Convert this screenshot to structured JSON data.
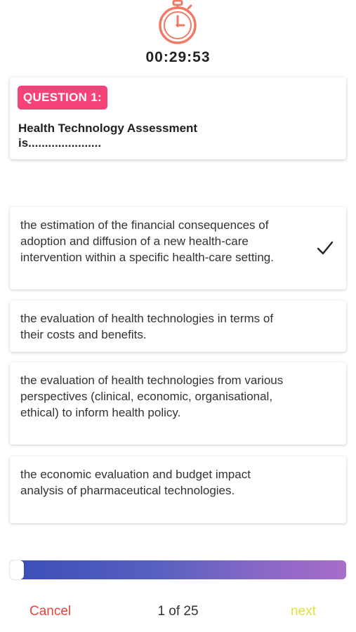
{
  "timer": {
    "value": "00:29:53"
  },
  "question": {
    "badge": "QUESTION 1:",
    "text": "Health Technology Assessment is......................"
  },
  "options": [
    {
      "text": "the estimation of the financial consequences of adoption and diffusion of a new health-care intervention within a specific health-care setting.",
      "selected": true
    },
    {
      "text": "the evaluation of health technologies in terms of their costs and benefits.",
      "selected": false
    },
    {
      "text": "the evaluation of health technologies from various perspectives (clinical, economic, organisational, ethical) to inform health policy.",
      "selected": false
    },
    {
      "text": "the economic evaluation and budget impact analysis of pharmaceutical technologies.",
      "selected": false
    }
  ],
  "progress": {
    "fraction": 0.04
  },
  "footer": {
    "cancel_label": "Cancel",
    "counter": "1 of 25",
    "next_label": "next"
  },
  "colors": {
    "accent": "#f5437a",
    "stopwatch": "#f07a65",
    "cancel": "#e5453a",
    "next": "#e3e13a",
    "progress_start": "#3b4db8",
    "progress_end": "#a86dca"
  },
  "icons": {
    "stopwatch": "stopwatch-icon",
    "selected": "checkmark-icon"
  }
}
